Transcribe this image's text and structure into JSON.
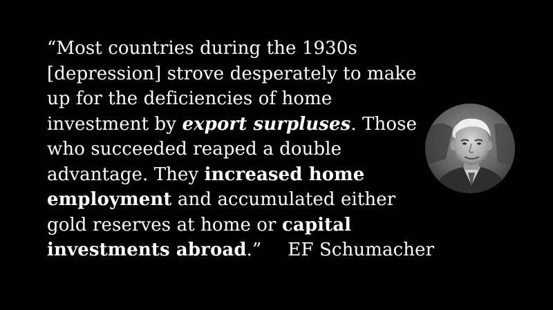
{
  "quote": {
    "l1": "“Most countries during the 1930s",
    "l2": "[depression] strove desperately to make",
    "l3": "up for the deficiencies of home",
    "l4a": "investment by ",
    "l4b": "export surpluses",
    "l4c": ". Those",
    "l5": "who succeeded reaped a double",
    "l6a": "advantage. They ",
    "l6b": "increased home",
    "l7a": "employment",
    "l7b": " and accumulated either",
    "l8a": "gold reserves at home or ",
    "l8b": "capital",
    "l9a": "investments abroad",
    "l9b": ".”"
  },
  "author": "EF Schumacher",
  "portrait_icon": "portrait-photo",
  "colors": {
    "background": "#000000",
    "text": "#ffffff"
  }
}
